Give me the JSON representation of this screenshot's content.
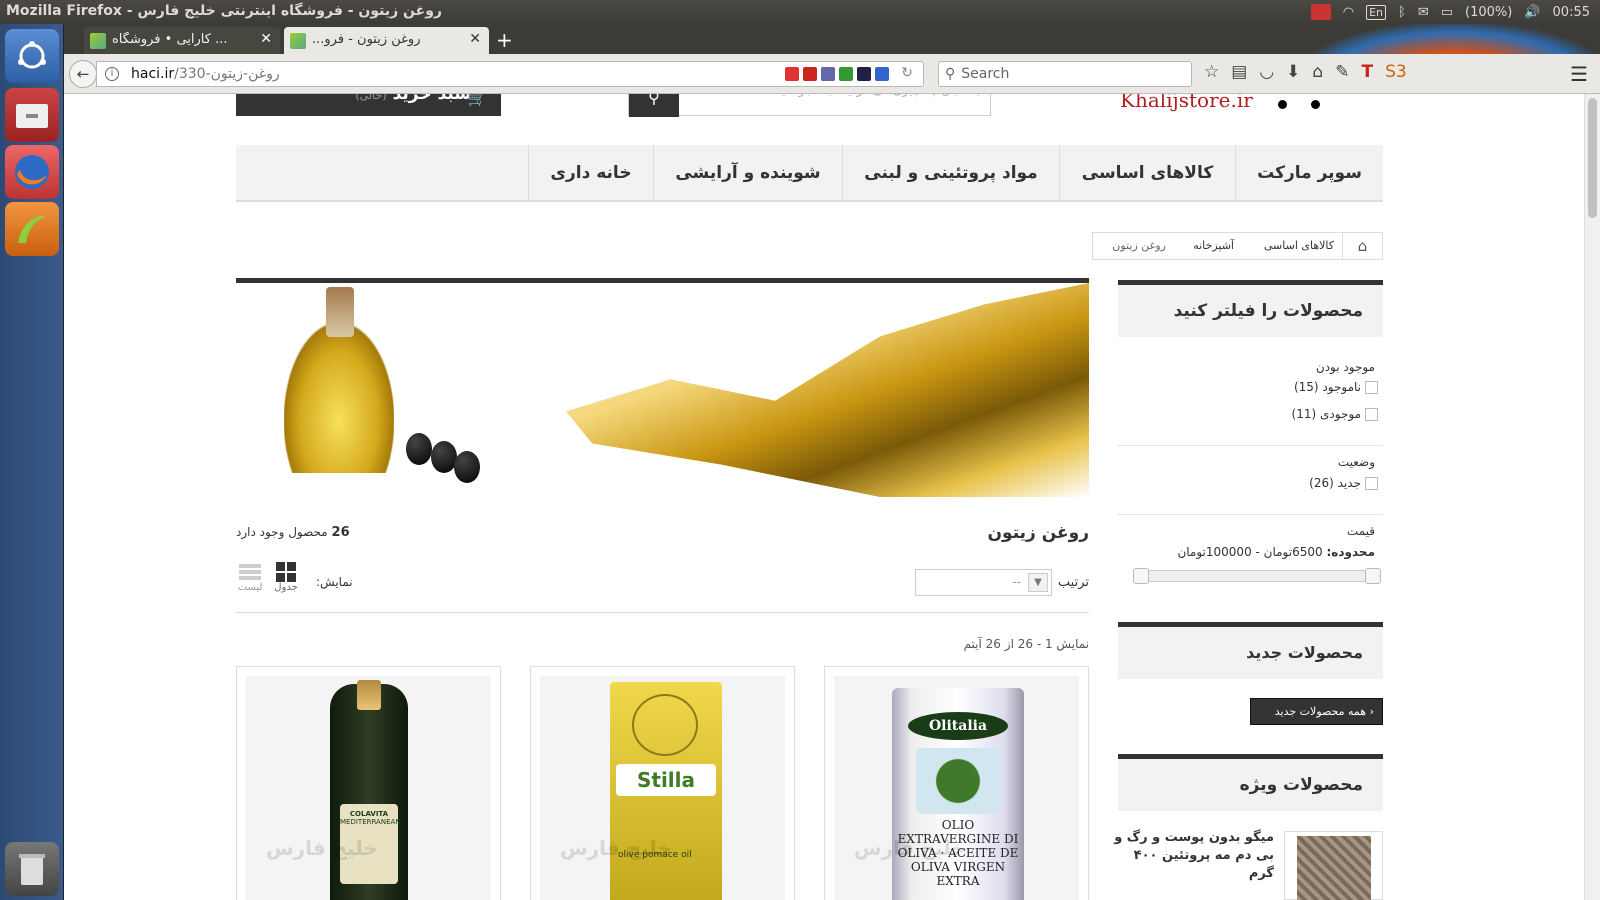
{
  "os": {
    "window_title": "Mozilla Firefox - روغن زیتون - فروشگاه اینترنتی خلیج فارس",
    "indicators": {
      "keyboard": "En",
      "battery": "(100%)",
      "clock": "00:55"
    }
  },
  "launcher": {
    "items": [
      "ubuntu-dash",
      "files",
      "firefox",
      "app",
      "trash"
    ]
  },
  "browser": {
    "tabs": [
      {
        "title": "... کارایی • فروشگاه",
        "active": false
      },
      {
        "title": "روغن زیتون - فرو...",
        "active": true
      }
    ],
    "url_host": "haci.ir",
    "url_path": "/330-روغن-زیتون",
    "search_placeholder": "Search"
  },
  "header": {
    "cart_label": "سبد خرید",
    "cart_state": "(خالی)",
    "search_placeholder": "به دنبال چه چیزی می گردید؛ جستجو کنید",
    "logo_text": "Khalijstore.ir"
  },
  "categories": [
    "سوپر مارکت",
    "کالاهای اساسی",
    "مواد پروتئینی و لبنی",
    "شوینده و آرایشی",
    "خانه داری"
  ],
  "breadcrumb": [
    "کالاهای اساسی",
    "آشپزخانه",
    "روغن زیتون"
  ],
  "filters": {
    "title": "محصولات را فیلتر کنید",
    "availability_label": "موجود بودن",
    "out_of_stock": "ناموجود (15)",
    "in_stock": "موجودی (11)",
    "condition_label": "وضعیت",
    "new_label": "جدید (26)",
    "price_label": "قیمت",
    "range_prefix": "محدوده:",
    "range_value": "6500تومان - 100000تومان"
  },
  "new_products": {
    "title": "محصولات جدید",
    "all_button": "همه محصولات جدید"
  },
  "special_products": {
    "title": "محصولات ویژه",
    "item_name": "میگو بدون پوست و رگ و بی دم مه پروتئین ۴۰۰ گرم"
  },
  "main": {
    "category_title": "روغن زیتون",
    "count_number": "26",
    "count_suffix": "محصول وجود دارد",
    "sort_label": "ترتیب",
    "sort_value": "--",
    "view_label": "نمایش:",
    "view_grid": "جدول",
    "view_list": "لیست",
    "showing": "نمایش 1 - 26 از 26 آیتم"
  },
  "products": [
    {
      "brand": "Olitalia",
      "label_text": "OLIO EXTRAVERGINE DI OLIVA · ACEITE DE OLIVA VIRGEN EXTRA"
    },
    {
      "brand": "Stilla",
      "label_text": "olive pomace oil"
    },
    {
      "brand": "COLAVITA",
      "label_text": "MEDITERRANEAN"
    }
  ],
  "watermark": "خلیج فارس",
  "colors": {
    "dark": "#333333",
    "logo_red": "#b01e23",
    "panel_bg": "#3c3b37"
  }
}
